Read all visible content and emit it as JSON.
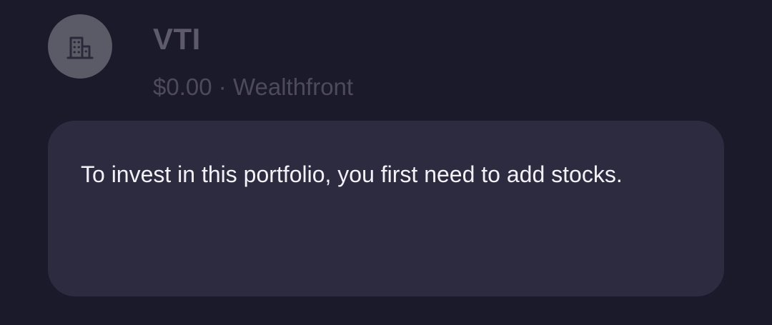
{
  "holding": {
    "icon": "building-icon",
    "ticker": "VTI",
    "value": "$0.00",
    "separator": "·",
    "provider": "Wealthfront"
  },
  "notice": {
    "message": "To invest in this portfolio, you first need to add stocks."
  },
  "colors": {
    "background": "#1b1a2b",
    "card": "#2d2b40",
    "avatar": "#5b5a67",
    "muted_text": "#5d5b6b",
    "primary_text": "#f2f1f6"
  }
}
